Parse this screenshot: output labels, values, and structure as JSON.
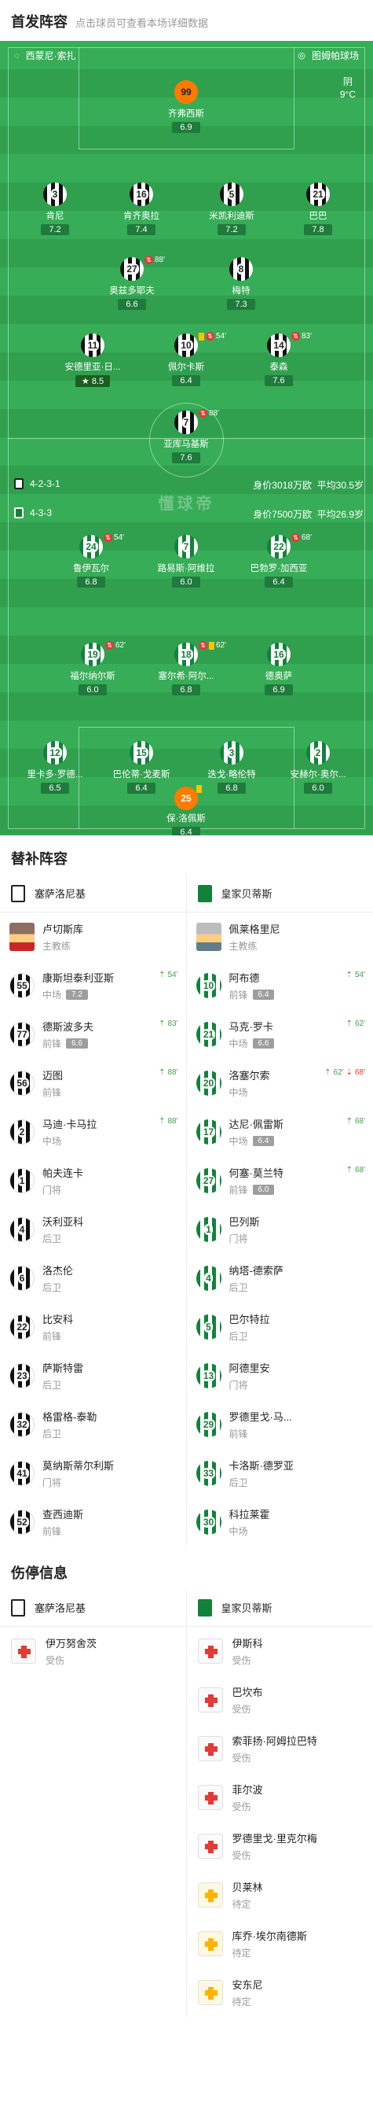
{
  "header": {
    "title": "首发阵容",
    "hint": "点击球员可查看本场详细数据"
  },
  "match": {
    "home_team": "西蒙尼·索扎",
    "venue": "图姆帕球场",
    "weather": {
      "condition": "阴",
      "temp": "9°C"
    },
    "colors": {
      "pitch": "#34a853",
      "rating_bg": "#1f7a3c",
      "keeper": "#ff7a00"
    }
  },
  "home": {
    "formation": "4-2-3-1",
    "value": "身价3018万欧",
    "age": "平均30.5岁",
    "players": [
      {
        "num": "99",
        "name": "齐弗西斯",
        "rating": "6.9"
      },
      {
        "num": "3",
        "name": "肯尼",
        "rating": "7.2"
      },
      {
        "num": "16",
        "name": "肯齐奥拉",
        "rating": "7.4"
      },
      {
        "num": "5",
        "name": "米凯利迪斯",
        "rating": "7.2"
      },
      {
        "num": "21",
        "name": "巴巴",
        "rating": "7.8"
      },
      {
        "num": "27",
        "name": "奥兹多耶夫",
        "rating": "6.6",
        "event": "88'"
      },
      {
        "num": "8",
        "name": "梅特",
        "rating": "7.3"
      },
      {
        "num": "11",
        "name": "安德里亚·日...",
        "rating": "8.5"
      },
      {
        "num": "10",
        "name": "佩尔卡斯",
        "rating": "6.4",
        "event": "54'"
      },
      {
        "num": "14",
        "name": "泰森",
        "rating": "7.6",
        "event": "83'"
      },
      {
        "num": "7",
        "name": "亚库马基斯",
        "rating": "7.6",
        "event": "88'"
      }
    ]
  },
  "away": {
    "formation": "4-3-3",
    "value": "身价7500万欧",
    "age": "平均26.9岁",
    "players": [
      {
        "num": "24",
        "name": "鲁伊瓦尔",
        "rating": "6.8",
        "event": "54'"
      },
      {
        "num": "7",
        "name": "路易斯·阿维拉",
        "rating": "6.0"
      },
      {
        "num": "22",
        "name": "巴勃罗·加西亚",
        "rating": "6.4",
        "event": "68'"
      },
      {
        "num": "19",
        "name": "福尔纳尔斯",
        "rating": "6.0",
        "event": "62'"
      },
      {
        "num": "18",
        "name": "塞尔希·阿尔...",
        "rating": "6.8",
        "event": "62'"
      },
      {
        "num": "16",
        "name": "德奥萨",
        "rating": "6.9"
      },
      {
        "num": "12",
        "name": "里卡多·罗德...",
        "rating": "6.5"
      },
      {
        "num": "15",
        "name": "巴伦蒂·戈麦斯",
        "rating": "6.4"
      },
      {
        "num": "3",
        "name": "迭戈·略伦特",
        "rating": "6.8"
      },
      {
        "num": "2",
        "name": "安赫尔·奥尔...",
        "rating": "6.0"
      },
      {
        "num": "25",
        "name": "保·洛佩斯",
        "rating": "6.4"
      }
    ]
  },
  "watermark": "懂球帝",
  "subs": {
    "title": "替补阵容",
    "home_team": "塞萨洛尼基",
    "away_team": "皇家贝蒂斯",
    "home_coach": {
      "name": "卢切斯库",
      "role": "主教练"
    },
    "away_coach": {
      "name": "佩莱格里尼",
      "role": "主教练"
    },
    "home": [
      {
        "num": "55",
        "name": "康斯坦泰利亚斯",
        "pos": "中场",
        "rating": "7.2",
        "time": "54'"
      },
      {
        "num": "77",
        "name": "德斯波多夫",
        "pos": "前锋",
        "rating": "6.6",
        "time": "83'"
      },
      {
        "num": "56",
        "name": "迈图",
        "pos": "前锋",
        "time": "88'"
      },
      {
        "num": "2",
        "name": "马迪·卡马拉",
        "pos": "中场",
        "time": "88'"
      },
      {
        "num": "1",
        "name": "帕夫连卡",
        "pos": "门将"
      },
      {
        "num": "4",
        "name": "沃利亚科",
        "pos": "后卫"
      },
      {
        "num": "6",
        "name": "洛杰伦",
        "pos": "后卫"
      },
      {
        "num": "22",
        "name": "比安科",
        "pos": "前锋"
      },
      {
        "num": "23",
        "name": "萨斯特雷",
        "pos": "后卫"
      },
      {
        "num": "32",
        "name": "格雷格-泰勒",
        "pos": "后卫"
      },
      {
        "num": "41",
        "name": "莫纳斯蒂尔利斯",
        "pos": "门将"
      },
      {
        "num": "52",
        "name": "查西迪斯",
        "pos": "前锋"
      }
    ],
    "away": [
      {
        "num": "10",
        "name": "阿布德",
        "pos": "前锋",
        "rating": "6.4",
        "time": "54'"
      },
      {
        "num": "21",
        "name": "马克·罗卡",
        "pos": "中场",
        "rating": "6.6",
        "time": "62'"
      },
      {
        "num": "20",
        "name": "洛塞尔索",
        "pos": "中场",
        "time": "62'",
        "time2": "68'"
      },
      {
        "num": "17",
        "name": "达尼·佩雷斯",
        "pos": "中场",
        "rating": "6.4",
        "time": "68'"
      },
      {
        "num": "27",
        "name": "何塞·莫兰特",
        "pos": "前锋",
        "rating": "6.0",
        "time": "68'"
      },
      {
        "num": "1",
        "name": "巴列斯",
        "pos": "门将"
      },
      {
        "num": "4",
        "name": "纳塔-德索萨",
        "pos": "后卫"
      },
      {
        "num": "5",
        "name": "巴尔特拉",
        "pos": "后卫"
      },
      {
        "num": "13",
        "name": "阿德里安",
        "pos": "门将"
      },
      {
        "num": "29",
        "name": "罗德里戈·马...",
        "pos": "前锋"
      },
      {
        "num": "33",
        "name": "卡洛斯·德罗亚",
        "pos": "后卫"
      },
      {
        "num": "30",
        "name": "科拉莱霍",
        "pos": "中场"
      }
    ]
  },
  "injuries": {
    "title": "伤停信息",
    "home_team": "塞萨洛尼基",
    "away_team": "皇家贝蒂斯",
    "home": [
      {
        "name": "伊万努舍茨",
        "status": "受伤",
        "type": "red"
      }
    ],
    "away": [
      {
        "name": "伊斯科",
        "status": "受伤",
        "type": "red"
      },
      {
        "name": "巴坎布",
        "status": "受伤",
        "type": "red"
      },
      {
        "name": "索菲扬·阿姆拉巴特",
        "status": "受伤",
        "type": "red"
      },
      {
        "name": "菲尔波",
        "status": "受伤",
        "type": "red"
      },
      {
        "name": "罗德里戈·里克尔梅",
        "status": "受伤",
        "type": "red"
      },
      {
        "name": "贝莱林",
        "status": "待定",
        "type": "yellow"
      },
      {
        "name": "库乔·埃尔南德斯",
        "status": "待定",
        "type": "yellow"
      },
      {
        "name": "安东尼",
        "status": "待定",
        "type": "yellow"
      }
    ]
  }
}
